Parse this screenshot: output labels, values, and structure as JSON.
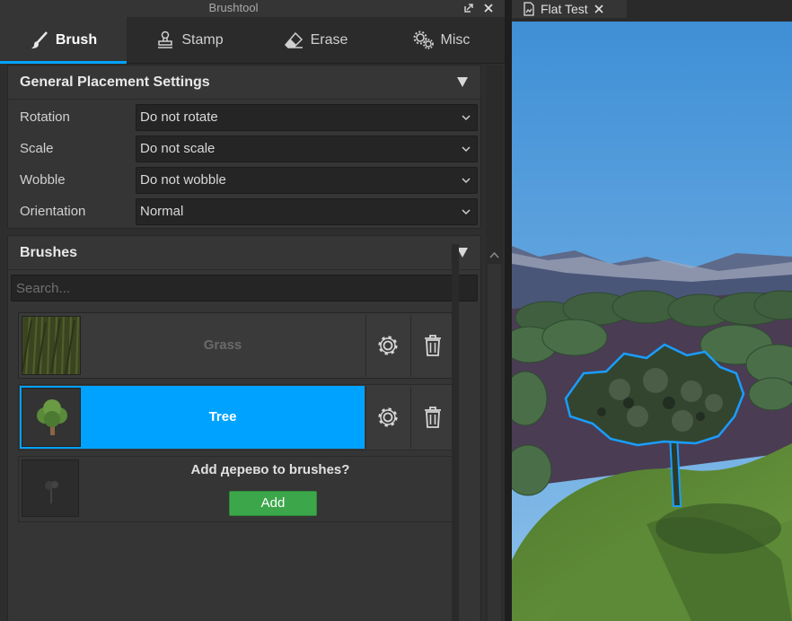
{
  "panel": {
    "title": "Brushtool"
  },
  "tabs": [
    {
      "label": "Brush",
      "icon": "paintbrush-icon",
      "active": true
    },
    {
      "label": "Stamp",
      "icon": "stamp-icon",
      "active": false
    },
    {
      "label": "Erase",
      "icon": "eraser-icon",
      "active": false
    },
    {
      "label": "Misc",
      "icon": "gears-icon",
      "active": false
    }
  ],
  "general": {
    "title": "General Placement Settings",
    "rows": [
      {
        "label": "Rotation",
        "value": "Do not rotate"
      },
      {
        "label": "Scale",
        "value": "Do not scale"
      },
      {
        "label": "Wobble",
        "value": "Do not wobble"
      },
      {
        "label": "Orientation",
        "value": "Normal"
      }
    ]
  },
  "brushes": {
    "title": "Brushes",
    "search_placeholder": "Search...",
    "items": [
      {
        "name": "Grass",
        "selected": false
      },
      {
        "name": "Tree",
        "selected": true
      }
    ],
    "add_prompt": "Add дерево to brushes?",
    "add_label": "Add"
  },
  "viewport": {
    "tab_label": "Flat Test"
  },
  "colors": {
    "accent": "#00a2ff",
    "add_button": "#3ca74a",
    "panel_bg": "#2e2e2e"
  }
}
